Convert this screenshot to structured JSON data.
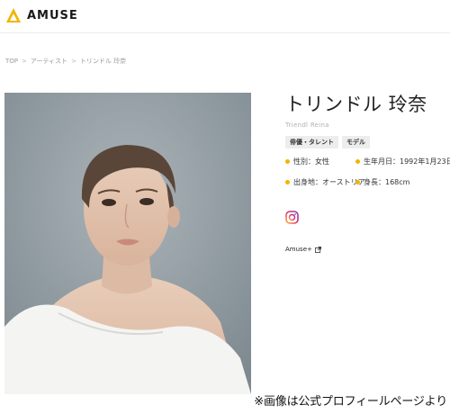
{
  "header": {
    "brand": "AMUSE",
    "logo_icon": "amuse-logo-icon",
    "accent_color": "#f1b400"
  },
  "breadcrumb": [
    {
      "label": "TOP"
    },
    {
      "label": "アーティスト"
    },
    {
      "label": "トリンドル 玲奈"
    }
  ],
  "breadcrumb_separator": ">",
  "profile": {
    "name": "トリンドル 玲奈",
    "name_en": "Triendl Reina",
    "tags": [
      "俳優・タレント",
      "モデル"
    ],
    "facts": [
      {
        "label": "性別：女性"
      },
      {
        "label": "生年月日：1992年1月23日"
      },
      {
        "label": "出身地：オーストリア"
      },
      {
        "label": "身長：168cm"
      }
    ],
    "social_icon": "instagram-icon",
    "amuse_plus": "Amuse+",
    "amuse_plus_icon": "external-link-icon"
  },
  "photo": {
    "alt_icon": "artist-portrait-photo"
  },
  "caption": "※画像は公式プロフィールページより"
}
